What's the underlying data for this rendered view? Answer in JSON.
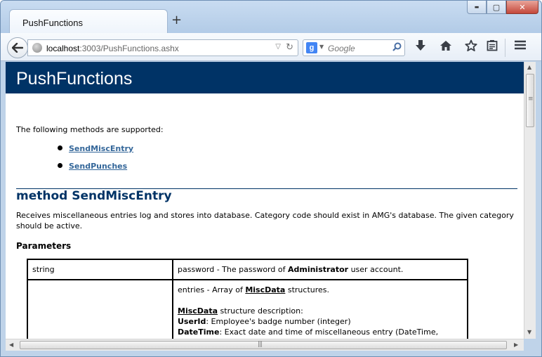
{
  "browser": {
    "tab_title": "PushFunctions",
    "new_tab": "+",
    "url_host": "localhost",
    "url_rest": ":3003/PushFunctions.ashx",
    "search_engine": "g",
    "search_placeholder": "Google",
    "window_buttons": {
      "minimize": "▬",
      "maximize": "▢",
      "close": "✕"
    }
  },
  "page": {
    "heading": "PushFunctions",
    "intro": "The following methods are supported:",
    "methods": [
      {
        "label": "SendMiscEntry"
      },
      {
        "label": "SendPunches"
      }
    ],
    "method_title": "method SendMiscEntry",
    "description": "Receives miscellaneous entries log and stores into database. Category code should exist in AMG's database. The given category should be active.",
    "parameters_heading": "Parameters",
    "params": [
      {
        "type": "string",
        "desc_prefix": "password - The password of ",
        "desc_bold": "Administrator",
        "desc_suffix": " user account."
      },
      {
        "type": "",
        "entries_prefix": "entries - Array of ",
        "entries_link": "MiscData",
        "entries_suffix": " structures.",
        "struct_link": "MiscData",
        "struct_suffix": " structure description:",
        "f1_name": "UserId",
        "f1_desc": ": Employee's badge number (integer)",
        "f2_name": "DateTime",
        "f2_desc": ": Exact date and time of miscellaneous entry (DateTime,"
      }
    ]
  },
  "scroll": {
    "h_grip": "|||",
    "v_grip": "≡"
  }
}
